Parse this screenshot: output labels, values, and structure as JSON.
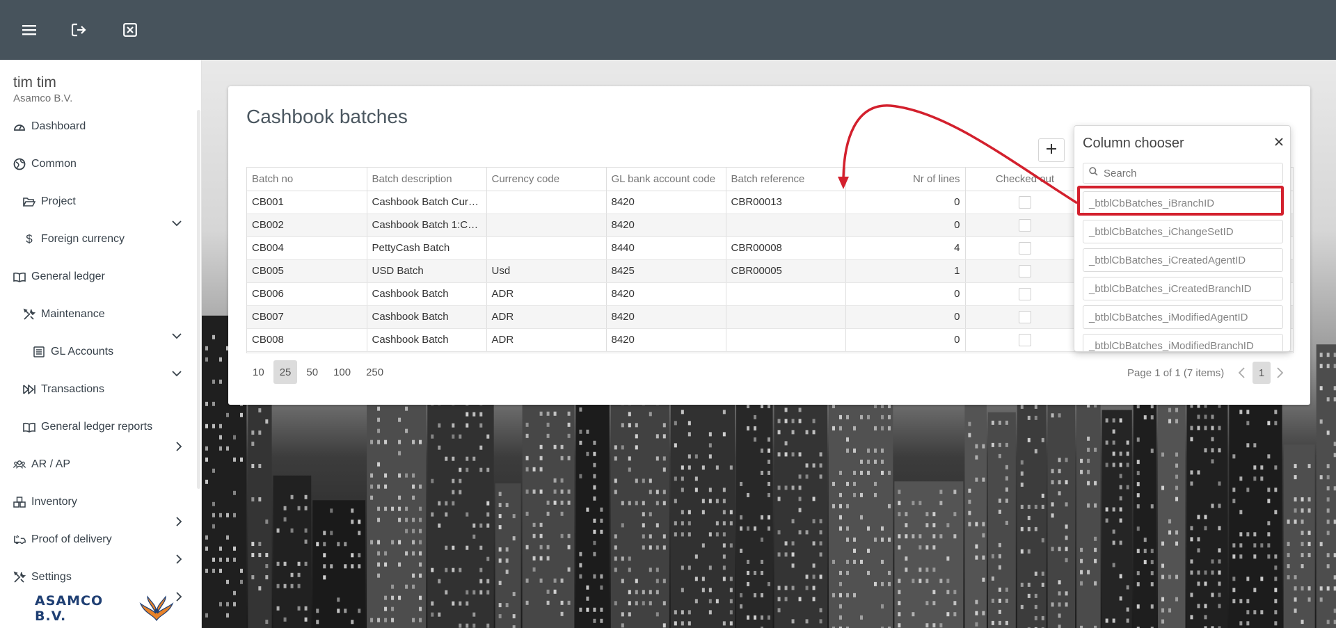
{
  "topbar": {
    "menu_icon": "hamburger-icon",
    "logout_icon": "logout-icon",
    "close_icon": "close-square-icon",
    "bg_color": "#47535c"
  },
  "user": {
    "name": "tim tim",
    "company": "Asamco B.V."
  },
  "sidebar": {
    "items": [
      {
        "label": "Dashboard",
        "icon": "dashboard-icon"
      },
      {
        "label": "Common",
        "icon": "globe-icon",
        "chevron": "down"
      },
      {
        "label": "Project",
        "icon": "folder-open-icon"
      },
      {
        "label": "Foreign currency",
        "icon": "dollar-icon"
      },
      {
        "label": "General ledger",
        "icon": "book-icon",
        "chevron": "down"
      },
      {
        "label": "Maintenance",
        "icon": "tools-icon",
        "chevron": "down"
      },
      {
        "label": "GL Accounts",
        "icon": "list-icon"
      },
      {
        "label": "Transactions",
        "icon": "transactions-icon",
        "chevron": "right"
      },
      {
        "label": "General ledger reports",
        "icon": "book-icon"
      },
      {
        "label": "AR / AP",
        "icon": "users-icon",
        "chevron": "right"
      },
      {
        "label": "Inventory",
        "icon": "boxes-icon",
        "chevron": "right"
      },
      {
        "label": "Proof of delivery",
        "icon": "truck-icon",
        "chevron": "right"
      },
      {
        "label": "Settings",
        "icon": "tools-icon",
        "chevron": "right"
      }
    ],
    "brand": "ASAMCO B.V."
  },
  "main": {
    "title": "Cashbook batches",
    "columns": [
      "Batch no",
      "Batch description",
      "Currency code",
      "GL bank account code",
      "Batch reference",
      "Nr of lines",
      "Checked out"
    ],
    "rows": [
      {
        "batch_no": "CB001",
        "description": "Cashbook Batch Curre...",
        "currency": "",
        "gl_code": "8420",
        "reference": "CBR00013",
        "lines": "0"
      },
      {
        "batch_no": "CB002",
        "description": "Cashbook Batch 1:Cur...",
        "currency": "",
        "gl_code": "8420",
        "reference": "",
        "lines": "0"
      },
      {
        "batch_no": "CB004",
        "description": "PettyCash Batch",
        "currency": "",
        "gl_code": "8440",
        "reference": "CBR00008",
        "lines": "4"
      },
      {
        "batch_no": "CB005",
        "description": "USD Batch",
        "currency": "Usd",
        "gl_code": "8425",
        "reference": "CBR00005",
        "lines": "1"
      },
      {
        "batch_no": "CB006",
        "description": "Cashbook Batch",
        "currency": "ADR",
        "gl_code": "8420",
        "reference": "",
        "lines": "0"
      },
      {
        "batch_no": "CB007",
        "description": "Cashbook Batch",
        "currency": "ADR",
        "gl_code": "8420",
        "reference": "",
        "lines": "0"
      },
      {
        "batch_no": "CB008",
        "description": "Cashbook Batch",
        "currency": "ADR",
        "gl_code": "8420",
        "reference": "",
        "lines": "0"
      }
    ],
    "page_sizes": [
      "10",
      "25",
      "50",
      "100",
      "250"
    ],
    "selected_page_size": "25",
    "pager_info": "Page 1 of 1 (7 items)",
    "current_page": "1"
  },
  "column_chooser": {
    "title": "Column chooser",
    "search_placeholder": "Search",
    "items": [
      "_btblCbBatches_iBranchID",
      "_btblCbBatches_iChangeSetID",
      "_btblCbBatches_iCreatedAgentID",
      "_btblCbBatches_iCreatedBranchID",
      "_btblCbBatches_iModifiedAgentID",
      "_btblCbBatches_iModifiedBranchID"
    ],
    "highlighted_item": "_btblCbBatches_iBranchID"
  },
  "annotation": {
    "color": "#d3202d"
  }
}
